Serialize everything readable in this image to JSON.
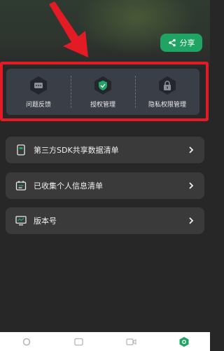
{
  "header": {
    "share_label": "分享",
    "accent_color": "#1fa463"
  },
  "quick_actions": [
    {
      "label": "问题反馈",
      "icon": "chat-bubble-icon"
    },
    {
      "label": "授权管理",
      "icon": "shield-check-icon"
    },
    {
      "label": "隐私权限管理",
      "icon": "lock-icon"
    }
  ],
  "menu": [
    {
      "label": "第三方SDK共享数据清单",
      "icon": "document-icon"
    },
    {
      "label": "已收集个人信息清单",
      "icon": "calendar-list-icon"
    },
    {
      "label": "版本号",
      "icon": "monitor-icon"
    }
  ],
  "bottom_nav": [
    {
      "icon": "circle-tab-icon"
    },
    {
      "icon": "square-tab-icon"
    },
    {
      "icon": "video-tab-icon"
    },
    {
      "icon": "hexagon-tab-icon",
      "active": true
    }
  ],
  "annotation": {
    "highlight_color": "#e21b24"
  }
}
